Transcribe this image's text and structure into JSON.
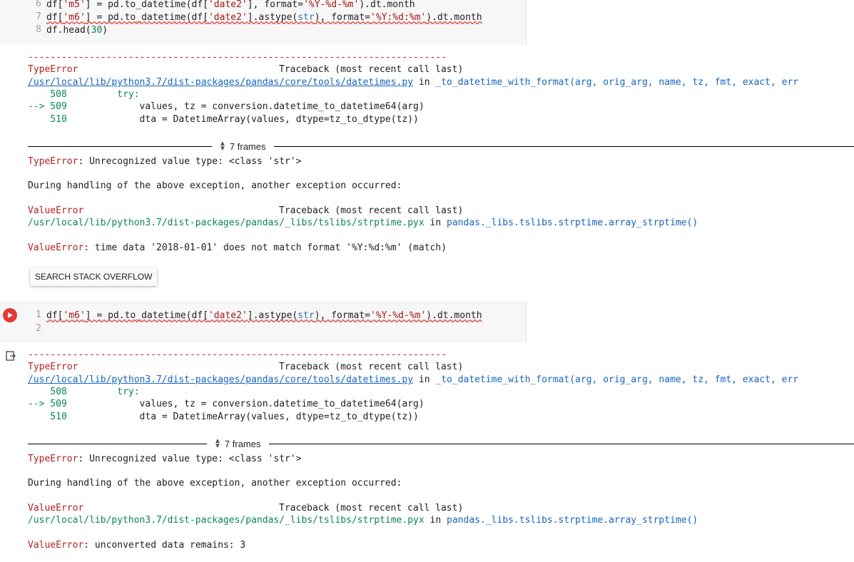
{
  "cell1": {
    "lines": [
      {
        "num": "6",
        "parts": [
          "df[",
          "'m5'",
          "] = pd.to_datetime(df[",
          "'date2'",
          "], format=",
          "'%Y-%d-%m'",
          ").dt.month"
        ]
      },
      {
        "num": "7",
        "parts": [
          "df[",
          "'m6'",
          "] = pd.to_datetime(df[",
          "'date2'",
          "].astype(",
          "str",
          "), format=",
          "'%Y:%d:%m'",
          ").dt.month"
        ]
      },
      {
        "num": "8",
        "parts": [
          "df.head(",
          "30",
          ")"
        ]
      }
    ]
  },
  "output1": {
    "dashes": "---------------------------------------------------------------------------",
    "err1_name": "TypeError",
    "err1_tb": "Traceback (most recent call last)",
    "err1_path": "/usr/local/lib/python3.7/dist-packages/pandas/core/tools/datetimes.py",
    "err1_in": " in ",
    "err1_fn": "_to_datetime_with_format",
    "err1_args": "(arg, orig_arg, name, tz, fmt, exact, err",
    "src508_num": "    508",
    "src508_code": "         try:",
    "src509_arrow": "--> 509",
    "src509_code": "             values, tz = conversion.datetime_to_datetime64(arg)",
    "src510_num": "    510",
    "src510_code": "             dta = DatetimeArray(values, dtype=tz_to_dtype(tz))",
    "frames_label": "7 frames",
    "typeerr_name": "TypeError",
    "typeerr_msg": ": Unrecognized value type: <class 'str'>",
    "during": "During handling of the above exception, another exception occurred:",
    "err2_name": "ValueError",
    "err2_tb": "Traceback (most recent call last)",
    "err2_path": "/usr/local/lib/python3.7/dist-packages/pandas/_libs/tslibs/strptime.pyx",
    "err2_in": " in ",
    "err2_fn": "pandas._libs.tslibs.strptime.array_strptime()",
    "final_name": "ValueError",
    "final_msg": ": time data '2018-01-01' does not match format '%Y:%d:%m' (match)",
    "so_button": "SEARCH STACK OVERFLOW"
  },
  "cell2": {
    "lines": [
      {
        "num": "1",
        "parts": [
          "df[",
          "'m6'",
          "] = pd.to_datetime(df[",
          "'date2'",
          "].astype(",
          "str",
          "), format=",
          "'%Y-%d-%m'",
          ").dt.month"
        ]
      },
      {
        "num": "2",
        "parts": []
      }
    ]
  },
  "output2": {
    "dashes": "---------------------------------------------------------------------------",
    "err1_name": "TypeError",
    "err1_tb": "Traceback (most recent call last)",
    "err1_path": "/usr/local/lib/python3.7/dist-packages/pandas/core/tools/datetimes.py",
    "err1_in": " in ",
    "err1_fn": "_to_datetime_with_format",
    "err1_args": "(arg, orig_arg, name, tz, fmt, exact, err",
    "src508_num": "    508",
    "src508_code": "         try:",
    "src509_arrow": "--> 509",
    "src509_code": "             values, tz = conversion.datetime_to_datetime64(arg)",
    "src510_num": "    510",
    "src510_code": "             dta = DatetimeArray(values, dtype=tz_to_dtype(tz))",
    "frames_label": "7 frames",
    "typeerr_name": "TypeError",
    "typeerr_msg": ": Unrecognized value type: <class 'str'>",
    "during": "During handling of the above exception, another exception occurred:",
    "err2_name": "ValueError",
    "err2_tb": "Traceback (most recent call last)",
    "err2_path": "/usr/local/lib/python3.7/dist-packages/pandas/_libs/tslibs/strptime.pyx",
    "err2_in": " in ",
    "err2_fn": "pandas._libs.tslibs.strptime.array_strptime()",
    "final_name": "ValueError",
    "final_msg": ": unconverted data remains: 3"
  },
  "icons": {
    "run": "run-error-icon",
    "output": "output-icon",
    "frames": "chevron-updown-icon"
  }
}
